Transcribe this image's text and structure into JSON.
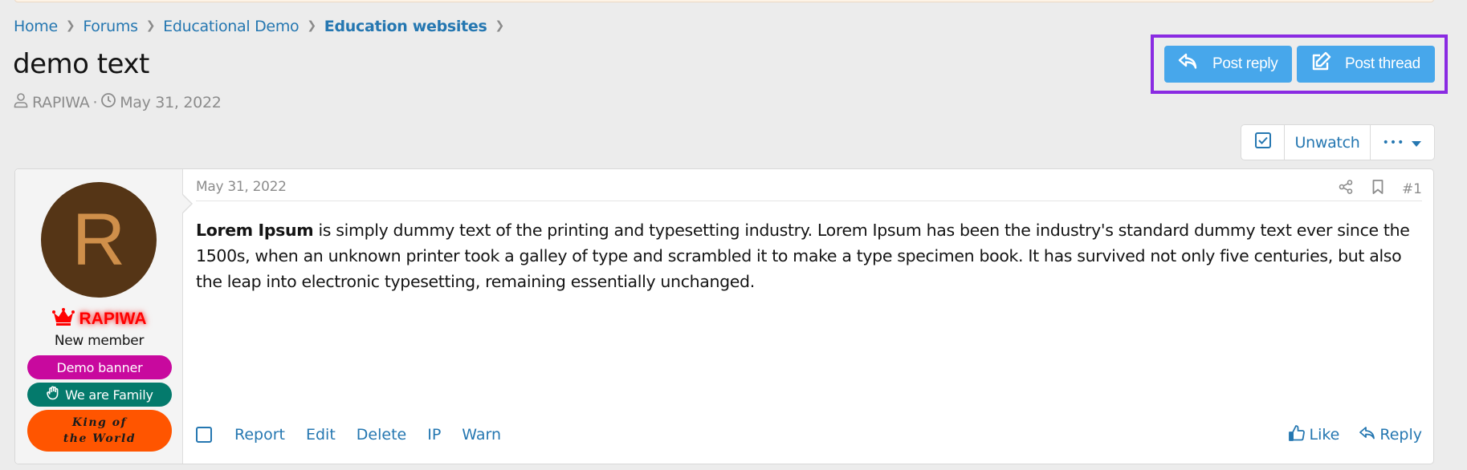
{
  "breadcrumb": [
    {
      "label": "Home"
    },
    {
      "label": "Forums"
    },
    {
      "label": "Educational Demo"
    },
    {
      "label": "Education websites"
    }
  ],
  "thread": {
    "title": "demo text",
    "author": "RAPIWA",
    "separator": "·",
    "date": "May 31, 2022"
  },
  "actions": {
    "post_reply": "Post reply",
    "post_thread": "Post thread",
    "unwatch": "Unwatch",
    "more": "•••"
  },
  "post": {
    "date": "May 31, 2022",
    "number": "#1",
    "body_bold": "Lorem Ipsum",
    "body_text": " is simply dummy text of the printing and typesetting industry. Lorem Ipsum has been the industry's standard dummy text ever since the 1500s, when an unknown printer took a galley of type and scrambled it to make a type specimen book. It has survived not only five centuries, but also the leap into electronic typesetting, remaining essentially unchanged.",
    "footer_left": [
      "Report",
      "Edit",
      "Delete",
      "IP",
      "Warn"
    ],
    "like": "Like",
    "reply": "Reply"
  },
  "user": {
    "avatar_letter": "R",
    "avatar_bg": "#553516",
    "avatar_fg": "#cf8f4a",
    "name": "RAPIWA",
    "name_color": "#ff0000",
    "title": "New member",
    "banners": [
      {
        "label": "Demo banner",
        "color": "#c8099e"
      },
      {
        "label": "We are Family",
        "color": "#047a6c"
      },
      {
        "label": "King of the World",
        "color": "#ff5500"
      }
    ]
  },
  "colors": {
    "link": "#2577b1",
    "primary_button": "#47a7eb",
    "highlight_box": "#8a2be2"
  }
}
